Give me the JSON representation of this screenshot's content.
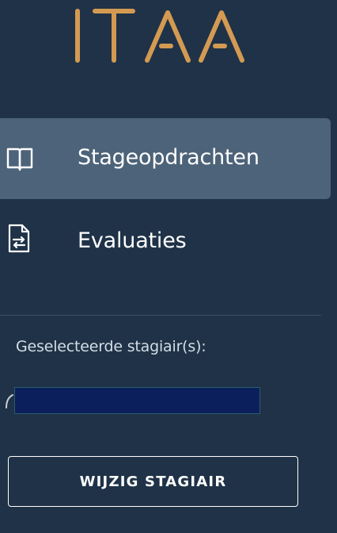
{
  "brand": {
    "logo_text": "ITAA",
    "logo_color": "#d49a52"
  },
  "nav": {
    "items": [
      {
        "label": "Stageopdrachten",
        "icon": "book-icon",
        "active": true
      },
      {
        "label": "Evaluaties",
        "icon": "document-exchange-icon",
        "active": false
      }
    ]
  },
  "trainee": {
    "selected_label": "Geselecteerde stagiair(s):",
    "field_value": "",
    "change_button_label": "WIJZIG STAGIAIR"
  },
  "colors": {
    "sidebar_bg": "#1f3247",
    "active_item_bg": "#4d6379",
    "field_bg": "#0a1f5c"
  }
}
